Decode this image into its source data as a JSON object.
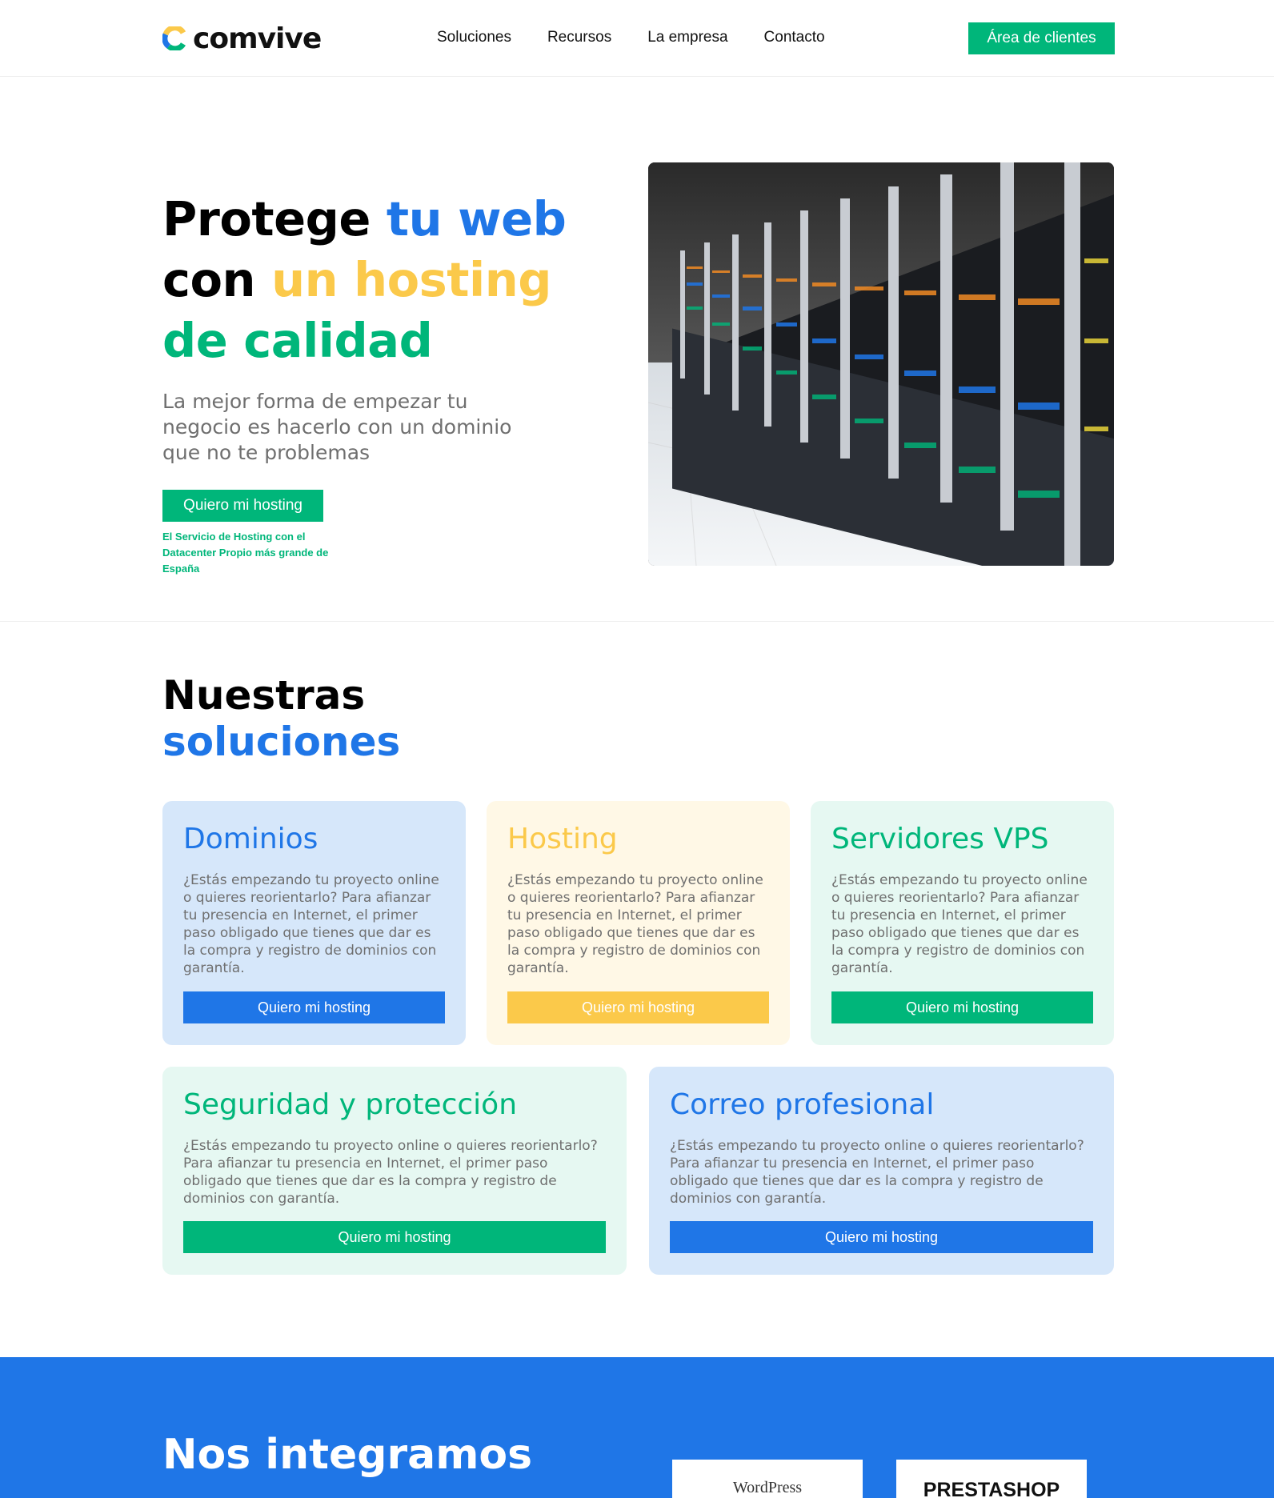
{
  "brand": {
    "name": "comvive"
  },
  "nav": {
    "items": [
      "Soluciones",
      "Recursos",
      "La empresa",
      "Contacto"
    ],
    "client_button": "Área de clientes"
  },
  "hero": {
    "title_part1": "Protege ",
    "title_part2": "tu web",
    "title_part3": "con ",
    "title_part4": "un hosting",
    "title_part5": "de calidad",
    "subtitle": "La mejor forma de empezar tu negocio es hacerlo con un dominio que no te problemas",
    "cta": "Quiero mi hosting",
    "note": "El Servicio de Hosting con el Datacenter Propio más grande de España"
  },
  "solutions": {
    "title_line1": "Nuestras",
    "title_line2": "soluciones",
    "cards": [
      {
        "title": "Dominios",
        "text": "¿Estás empezando tu proyecto online o quieres reorientarlo? Para afianzar tu presencia en Internet, el primer paso obligado que tienes que dar es la compra y registro de dominios con garantía.",
        "button": "Quiero mi hosting",
        "color": "#1f76e7"
      },
      {
        "title": "Hosting",
        "text": "¿Estás empezando tu proyecto online o quieres reorientarlo? Para afianzar tu presencia en Internet, el primer paso obligado que tienes que dar es la compra y registro de dominios con garantía.",
        "button": "Quiero mi hosting",
        "color": "#fbc94a"
      },
      {
        "title": "Servidores VPS",
        "text": "¿Estás empezando tu proyecto online o quieres reorientarlo? Para afianzar tu presencia en Internet, el primer paso obligado que tienes que dar es la compra y registro de dominios con garantía.",
        "button": "Quiero mi hosting",
        "color": "#00b67a"
      },
      {
        "title": "Seguridad y protección",
        "text": "¿Estás empezando tu proyecto online o quieres reorientarlo? Para afianzar tu presencia en Internet, el primer paso obligado que tienes que dar es la compra y registro de dominios con garantía.",
        "button": "Quiero mi hosting",
        "color": "#00b67a"
      },
      {
        "title": "Correo profesional",
        "text": "¿Estás empezando tu proyecto online o quieres reorientarlo? Para afianzar tu presencia en Internet, el primer paso obligado que tienes que dar es la compra y registro de dominios con garantía.",
        "button": "Quiero mi hosting",
        "color": "#1f76e7"
      }
    ]
  },
  "integrations": {
    "title": "Nos integramos",
    "partners": [
      "WordPress",
      "PRESTASHOP"
    ]
  },
  "colors": {
    "blue": "#1f76e7",
    "yellow": "#fbc94a",
    "green": "#00b67a"
  }
}
